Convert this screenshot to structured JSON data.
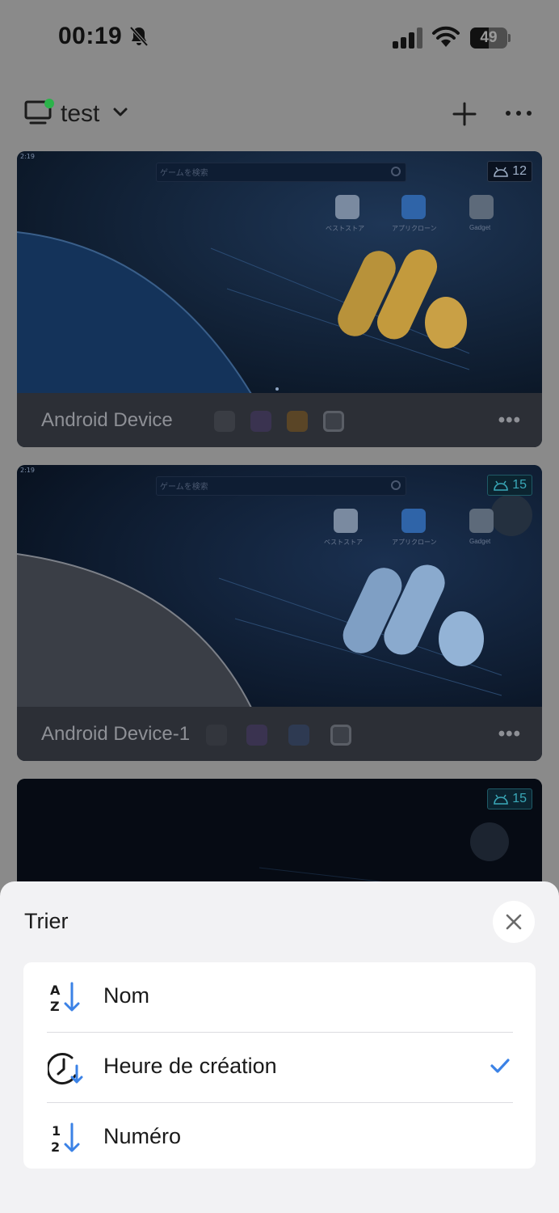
{
  "status_bar": {
    "time": "00:19",
    "battery_percent": "49",
    "battery_level": 0.49,
    "icons": [
      "bell-slash-icon",
      "cellular-signal-icon",
      "wifi-icon",
      "battery-icon"
    ]
  },
  "header": {
    "group_name": "test",
    "device_status_color": "#2bb34a",
    "icons": [
      "monitor-icon",
      "chevron-down-icon",
      "plus-icon",
      "more-horizontal-icon"
    ]
  },
  "devices": [
    {
      "name": "Android Device",
      "more_label": "•••",
      "android_version": "12",
      "search_placeholder": "ゲームを検索",
      "apps": [
        "ベストストア",
        "アプリクローン",
        "Gadget"
      ]
    },
    {
      "name": "Android Device-1",
      "more_label": "•••",
      "android_version": "15",
      "search_placeholder": "ゲームを検索",
      "apps": [
        "ベストストア",
        "アプリクローン",
        "Gadget"
      ]
    },
    {
      "android_version": "15"
    }
  ],
  "sort_sheet": {
    "title": "Trier",
    "options": [
      {
        "label": "Nom",
        "icon": "sort-alpha-icon",
        "selected": false
      },
      {
        "label": "Heure de création",
        "icon": "sort-time-icon",
        "selected": true
      },
      {
        "label": "Numéro",
        "icon": "sort-numeric-icon",
        "selected": false
      }
    ],
    "accent_color": "#3b82e6"
  }
}
